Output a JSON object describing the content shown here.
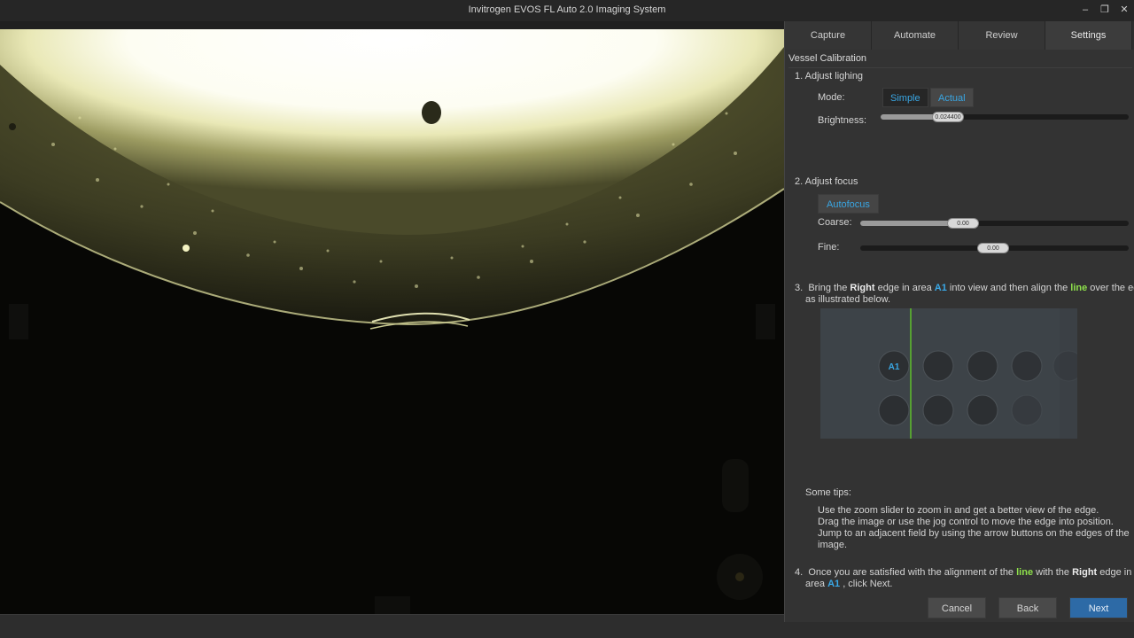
{
  "window": {
    "title": "Invitrogen EVOS FL Auto 2.0 Imaging System",
    "min_glyph": "–",
    "max_glyph": "❐",
    "close_glyph": "✕"
  },
  "tabs": [
    {
      "label": "Capture"
    },
    {
      "label": "Automate"
    },
    {
      "label": "Review"
    },
    {
      "label": "Settings",
      "active": true
    }
  ],
  "section_title": "Vessel Calibration",
  "step1": {
    "label": "1.  Adjust lighing",
    "mode_label": "Mode:",
    "mode_options": [
      "Simple",
      "Actual"
    ],
    "mode_selected": "Simple",
    "brightness_label": "Brightness:",
    "brightness_value": "0.024400"
  },
  "step2": {
    "label": "2.  Adjust focus",
    "autofocus_label": "Autofocus",
    "coarse_label": "Coarse:",
    "coarse_value": "0.00",
    "fine_label": "Fine:",
    "fine_value": "0.00"
  },
  "step3": {
    "num": "3.",
    "t1": "Bring the ",
    "edge": "Right",
    "t2": " edge in area ",
    "area": "A1",
    "t3": " into view and then align the ",
    "line": "line",
    "t4": " over the edge",
    "t5": "as illustrated below.",
    "diagram_well_label": "A1"
  },
  "tips": {
    "title": "Some tips:",
    "lines": [
      "Use the zoom slider to zoom in and get a better view of the edge.",
      "Drag the image or use the jog control to move the edge into position.",
      "Jump to an adjacent field by using the arrow buttons on the edges of the",
      "image."
    ]
  },
  "step4": {
    "num": "4.",
    "t1": "Once you are satisfied with the alignment of the ",
    "line": "line",
    "t2": " with the ",
    "edge": "Right",
    "t3": " edge in",
    "t4": "area ",
    "area": "A1",
    "t5": " , click Next."
  },
  "buttons": {
    "cancel": "Cancel",
    "back": "Back",
    "next": "Next"
  },
  "colors": {
    "accent_blue": "#3aa9e8",
    "accent_green": "#8ee04b",
    "primary_button": "#2d6aa6"
  }
}
